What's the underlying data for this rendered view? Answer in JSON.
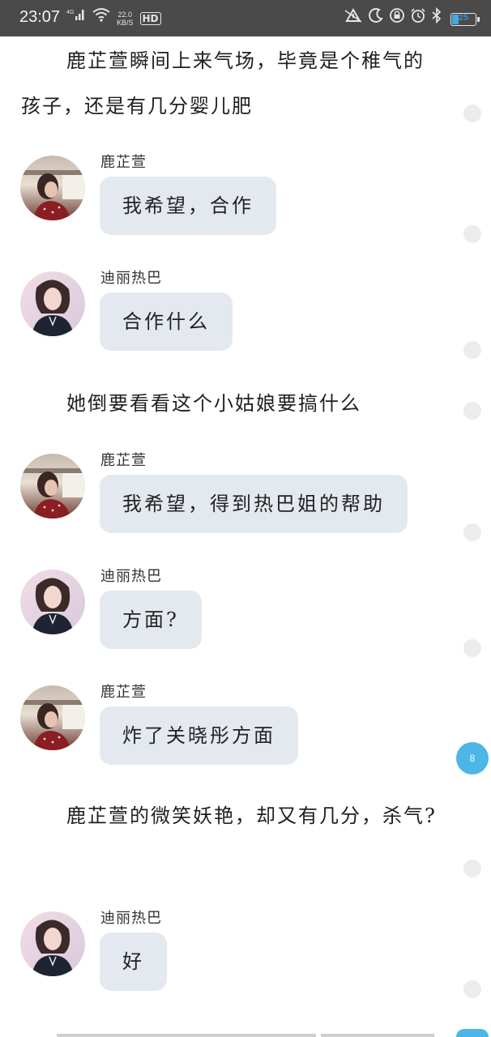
{
  "status_bar": {
    "time": "23:07",
    "network": "4G",
    "speed_value": "22.0",
    "speed_unit": "KB/S",
    "hd": "HD",
    "battery": "25",
    "battery_level": 0.25
  },
  "content": [
    {
      "type": "narration",
      "text": "鹿芷萱瞬间上来气场，毕竟是个稚气的孩子，还是有几分婴儿肥"
    },
    {
      "type": "message",
      "speaker": "鹿芷萱",
      "avatar": "avatar-lu",
      "text": "我希望，合作"
    },
    {
      "type": "message",
      "speaker": "迪丽热巴",
      "avatar": "avatar-dili",
      "text": "合作什么"
    },
    {
      "type": "narration",
      "text": "她倒要看看这个小姑娘要搞什么"
    },
    {
      "type": "message",
      "speaker": "鹿芷萱",
      "avatar": "avatar-lu",
      "text": "我希望，得到热巴姐的帮助"
    },
    {
      "type": "message",
      "speaker": "迪丽热巴",
      "avatar": "avatar-dili",
      "text": "方面?"
    },
    {
      "type": "message",
      "speaker": "鹿芷萱",
      "avatar": "avatar-lu",
      "text": "炸了关晓彤方面"
    },
    {
      "type": "narration",
      "text": "鹿芷萱的微笑妖艳，却又有几分，杀气?"
    },
    {
      "type": "message",
      "speaker": "迪丽热巴",
      "avatar": "avatar-dili",
      "text": "好"
    }
  ],
  "comment_badge": {
    "count": "8",
    "color": "#4cb6e6"
  },
  "colors": {
    "bubble": "#e4e9f0",
    "status_bar": "#4a4a4a",
    "comment_dot": "#ececec"
  }
}
